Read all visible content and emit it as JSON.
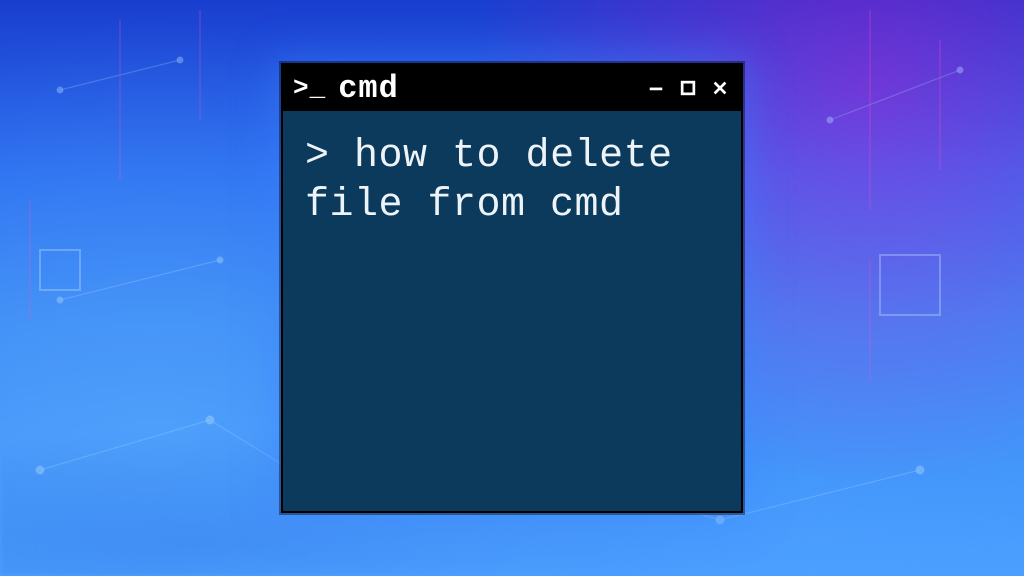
{
  "window": {
    "prompt_logo": ">_",
    "title": "cmd"
  },
  "terminal": {
    "prompt": ">",
    "command": "how to delete file from cmd"
  },
  "controls": {
    "minimize_label": "Minimize",
    "maximize_label": "Maximize",
    "close_label": "Close"
  }
}
